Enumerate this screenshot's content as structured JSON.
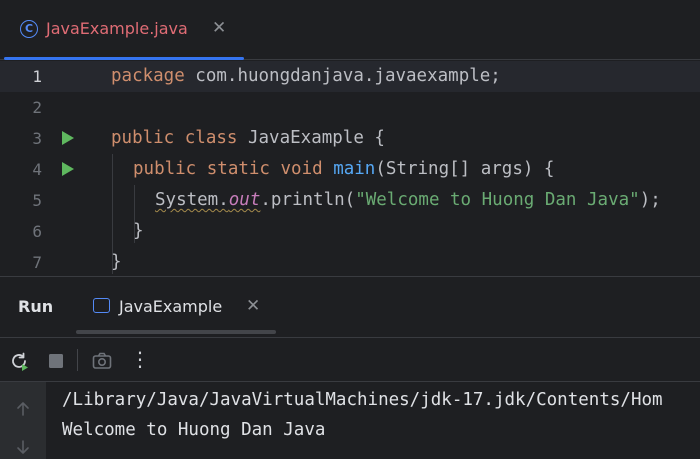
{
  "editor_tab": {
    "icon": "java-class-icon",
    "icon_glyph": "C",
    "filename": "JavaExample.java",
    "close_glyph": "✕"
  },
  "code": {
    "line_numbers": [
      "1",
      "2",
      "3",
      "4",
      "5",
      "6",
      "7"
    ],
    "line1": {
      "kw": "package",
      "rest": " com.huongdanjava.javaexample;"
    },
    "line3": {
      "kw": "public class",
      "rest": " JavaExample {"
    },
    "line4": {
      "kw": "public static void",
      "sp": " ",
      "fn": "main",
      "rest": "(String[] args) {"
    },
    "line5": {
      "obj": "System",
      "dot1": ".",
      "field": "out",
      "call": ".println(",
      "str": "\"Welcome to Huong Dan Java\"",
      "end": ");"
    },
    "line6": {
      "text": "}"
    },
    "line7": {
      "text": "}"
    }
  },
  "run_panel": {
    "title": "Run",
    "tab_label": "JavaExample",
    "tab_close": "✕",
    "toolbar": {
      "rerun": "rerun-icon",
      "stop": "stop-icon",
      "screenshot": "camera-icon",
      "more": "more-vertical-icon",
      "more_glyph": "⋮"
    },
    "console": {
      "lines": [
        "/Library/Java/JavaVirtualMachines/jdk-17.jdk/Contents/Hom",
        "Welcome to Huong Dan Java"
      ]
    }
  },
  "colors": {
    "background": "#1e1f22",
    "keyword": "#cf8e6d",
    "function": "#56a8f5",
    "string": "#6aab73",
    "static_field": "#c77dbb",
    "tab_accent": "#3574f0",
    "tab_text_error": "#e06c75",
    "run_gutter_icon": "#5fb85f"
  }
}
